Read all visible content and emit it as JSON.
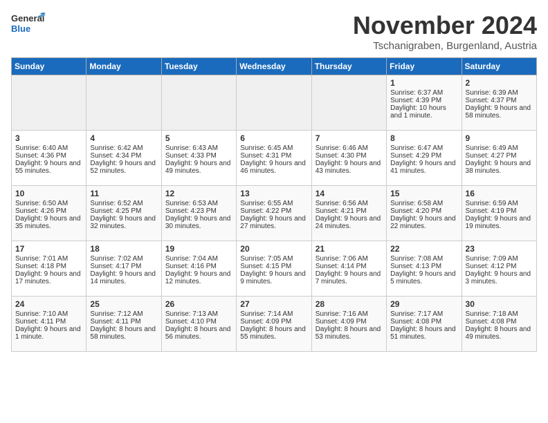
{
  "logo": {
    "general": "General",
    "blue": "Blue"
  },
  "header": {
    "month": "November 2024",
    "location": "Tschanigraben, Burgenland, Austria"
  },
  "days_of_week": [
    "Sunday",
    "Monday",
    "Tuesday",
    "Wednesday",
    "Thursday",
    "Friday",
    "Saturday"
  ],
  "weeks": [
    [
      {
        "day": "",
        "data": ""
      },
      {
        "day": "",
        "data": ""
      },
      {
        "day": "",
        "data": ""
      },
      {
        "day": "",
        "data": ""
      },
      {
        "day": "",
        "data": ""
      },
      {
        "day": "1",
        "data": "Sunrise: 6:37 AM\nSunset: 4:39 PM\nDaylight: 10 hours and 1 minute."
      },
      {
        "day": "2",
        "data": "Sunrise: 6:39 AM\nSunset: 4:37 PM\nDaylight: 9 hours and 58 minutes."
      }
    ],
    [
      {
        "day": "3",
        "data": "Sunrise: 6:40 AM\nSunset: 4:36 PM\nDaylight: 9 hours and 55 minutes."
      },
      {
        "day": "4",
        "data": "Sunrise: 6:42 AM\nSunset: 4:34 PM\nDaylight: 9 hours and 52 minutes."
      },
      {
        "day": "5",
        "data": "Sunrise: 6:43 AM\nSunset: 4:33 PM\nDaylight: 9 hours and 49 minutes."
      },
      {
        "day": "6",
        "data": "Sunrise: 6:45 AM\nSunset: 4:31 PM\nDaylight: 9 hours and 46 minutes."
      },
      {
        "day": "7",
        "data": "Sunrise: 6:46 AM\nSunset: 4:30 PM\nDaylight: 9 hours and 43 minutes."
      },
      {
        "day": "8",
        "data": "Sunrise: 6:47 AM\nSunset: 4:29 PM\nDaylight: 9 hours and 41 minutes."
      },
      {
        "day": "9",
        "data": "Sunrise: 6:49 AM\nSunset: 4:27 PM\nDaylight: 9 hours and 38 minutes."
      }
    ],
    [
      {
        "day": "10",
        "data": "Sunrise: 6:50 AM\nSunset: 4:26 PM\nDaylight: 9 hours and 35 minutes."
      },
      {
        "day": "11",
        "data": "Sunrise: 6:52 AM\nSunset: 4:25 PM\nDaylight: 9 hours and 32 minutes."
      },
      {
        "day": "12",
        "data": "Sunrise: 6:53 AM\nSunset: 4:23 PM\nDaylight: 9 hours and 30 minutes."
      },
      {
        "day": "13",
        "data": "Sunrise: 6:55 AM\nSunset: 4:22 PM\nDaylight: 9 hours and 27 minutes."
      },
      {
        "day": "14",
        "data": "Sunrise: 6:56 AM\nSunset: 4:21 PM\nDaylight: 9 hours and 24 minutes."
      },
      {
        "day": "15",
        "data": "Sunrise: 6:58 AM\nSunset: 4:20 PM\nDaylight: 9 hours and 22 minutes."
      },
      {
        "day": "16",
        "data": "Sunrise: 6:59 AM\nSunset: 4:19 PM\nDaylight: 9 hours and 19 minutes."
      }
    ],
    [
      {
        "day": "17",
        "data": "Sunrise: 7:01 AM\nSunset: 4:18 PM\nDaylight: 9 hours and 17 minutes."
      },
      {
        "day": "18",
        "data": "Sunrise: 7:02 AM\nSunset: 4:17 PM\nDaylight: 9 hours and 14 minutes."
      },
      {
        "day": "19",
        "data": "Sunrise: 7:04 AM\nSunset: 4:16 PM\nDaylight: 9 hours and 12 minutes."
      },
      {
        "day": "20",
        "data": "Sunrise: 7:05 AM\nSunset: 4:15 PM\nDaylight: 9 hours and 9 minutes."
      },
      {
        "day": "21",
        "data": "Sunrise: 7:06 AM\nSunset: 4:14 PM\nDaylight: 9 hours and 7 minutes."
      },
      {
        "day": "22",
        "data": "Sunrise: 7:08 AM\nSunset: 4:13 PM\nDaylight: 9 hours and 5 minutes."
      },
      {
        "day": "23",
        "data": "Sunrise: 7:09 AM\nSunset: 4:12 PM\nDaylight: 9 hours and 3 minutes."
      }
    ],
    [
      {
        "day": "24",
        "data": "Sunrise: 7:10 AM\nSunset: 4:11 PM\nDaylight: 9 hours and 1 minute."
      },
      {
        "day": "25",
        "data": "Sunrise: 7:12 AM\nSunset: 4:11 PM\nDaylight: 8 hours and 58 minutes."
      },
      {
        "day": "26",
        "data": "Sunrise: 7:13 AM\nSunset: 4:10 PM\nDaylight: 8 hours and 56 minutes."
      },
      {
        "day": "27",
        "data": "Sunrise: 7:14 AM\nSunset: 4:09 PM\nDaylight: 8 hours and 55 minutes."
      },
      {
        "day": "28",
        "data": "Sunrise: 7:16 AM\nSunset: 4:09 PM\nDaylight: 8 hours and 53 minutes."
      },
      {
        "day": "29",
        "data": "Sunrise: 7:17 AM\nSunset: 4:08 PM\nDaylight: 8 hours and 51 minutes."
      },
      {
        "day": "30",
        "data": "Sunrise: 7:18 AM\nSunset: 4:08 PM\nDaylight: 8 hours and 49 minutes."
      }
    ]
  ]
}
